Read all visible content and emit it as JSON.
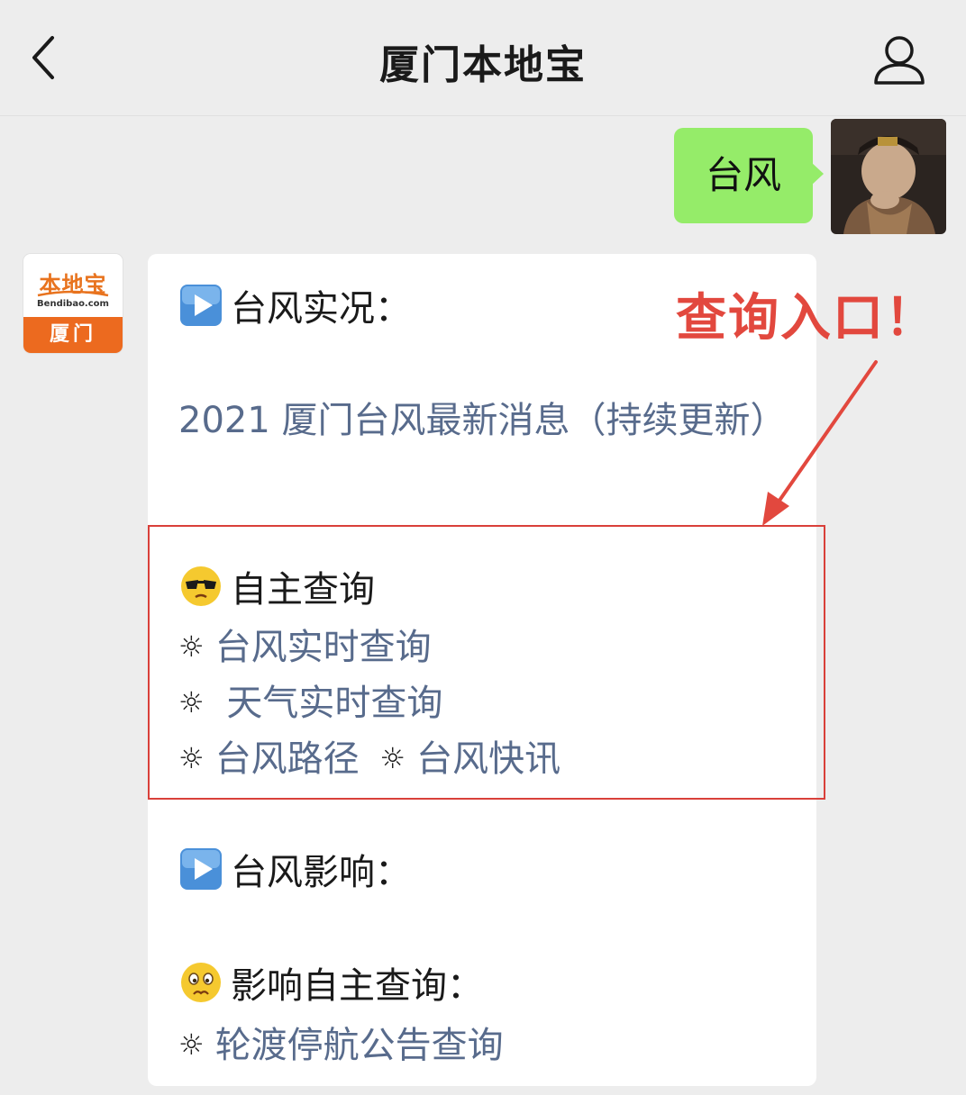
{
  "header": {
    "title": "厦门本地宝"
  },
  "chat": {
    "outgoing_text": "台风",
    "bot_logo": {
      "brand": "本地宝",
      "url": "Bendibao.com",
      "city": "厦门"
    },
    "sections": {
      "live_heading": "台风实况：",
      "news_link": "2021 厦门台风最新消息（持续更新）",
      "self_query_heading": "自主查询",
      "bullet": "☼",
      "typhoon_realtime": "台风实时查询",
      "weather_realtime": " 天气实时查询",
      "typhoon_path": "台风路径",
      "typhoon_news": "台风快讯",
      "impact_heading": "台风影响：",
      "impact_query_heading": "影响自主查询：",
      "ferry_notice": "轮渡停航公告查询"
    }
  },
  "annotation": {
    "label": "查询入口！",
    "color": "#e2483e"
  },
  "colors": {
    "background": "#ededed",
    "outgoing_bubble": "#95ec69",
    "link": "#586b8c",
    "brand_orange": "#ec6a1f"
  },
  "icons": [
    "back-arrow-icon",
    "profile-icon",
    "play-button-icon",
    "sunglasses-emoji-icon",
    "worried-emoji-icon",
    "sun-bullet-icon"
  ]
}
